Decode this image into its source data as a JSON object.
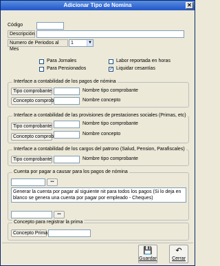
{
  "window": {
    "title": "Adicionar Tipo de Nomina",
    "close_glyph": "✕"
  },
  "form": {
    "codigo_label": "Código",
    "descripcion_label": "Descripción",
    "periodos_label": "Numero de Periodos al Mes",
    "periodos_value": "1",
    "checks": {
      "jornales": {
        "label": "Para Jornales",
        "checked": false
      },
      "pensionados": {
        "label": "Para Pensionados",
        "checked": false
      },
      "labor": {
        "label": "Labor reportada en horas",
        "checked": false
      },
      "cesantias": {
        "label": "Liquidar cesantías",
        "checked": true
      }
    }
  },
  "group1": {
    "title": "Interface a contabilidad de los pagos de nómina",
    "btn_tipo": "Tipo comprobante",
    "lbl_tipo": "Nombre tipo comprobante",
    "btn_concepto": "Concepto comprobante",
    "lbl_concepto": "Nombre concepto"
  },
  "group2": {
    "title": "Interface a contabilidad de las provisiones de prestaciones sociales (Primas, etc)",
    "btn_tipo": "Tipo comprobante",
    "lbl_tipo": "Nombre tipo comprobante",
    "btn_concepto": "Concepto comprobante",
    "lbl_concepto": "Nombre concepto"
  },
  "group3": {
    "title": "Interface a contabilidad de los cargos del patrono (Salud, Pension, Parafiscales)",
    "btn_tipo": "Tipo comprobante",
    "lbl_tipo": "Nombre tipo comprobante"
  },
  "group4": {
    "title": "Cuenta por pagar a causar para los pagos de nómina",
    "ellipsis": "•••",
    "note": "Generar la cuenta por pagar al siguiente nit para todos los pagos (Si lo deja en blanco se genera una cuenta por pagar por empleado - Cheques)"
  },
  "group5": {
    "title": "Concepto para registrar la prima",
    "btn": "Concepto Prima"
  },
  "footer": {
    "save": "Guardar",
    "close": "Cerrar",
    "save_icon": "💾",
    "close_icon": "↶"
  }
}
